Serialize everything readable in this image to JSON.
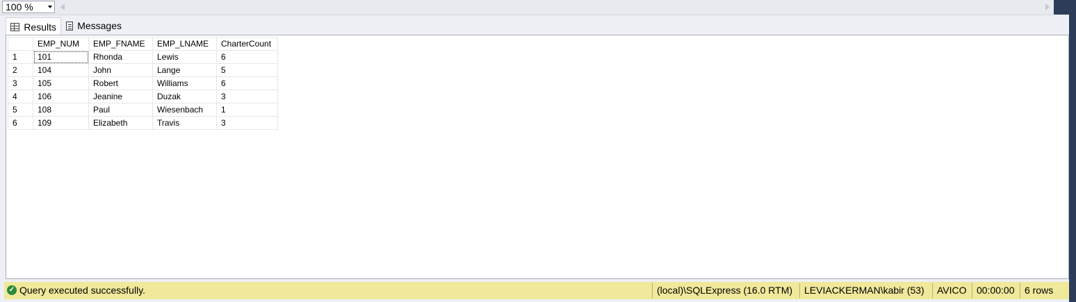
{
  "zoom": {
    "value": "100 %"
  },
  "tabs": [
    {
      "label": "Results",
      "icon": "grid-icon",
      "active": true
    },
    {
      "label": "Messages",
      "icon": "messages-icon",
      "active": false
    }
  ],
  "results": {
    "columns": [
      "",
      "EMP_NUM",
      "EMP_FNAME",
      "EMP_LNAME",
      "CharterCount"
    ],
    "rows": [
      {
        "n": "1",
        "emp_num": "101",
        "fname": "Rhonda",
        "lname": "Lewis",
        "count": "6"
      },
      {
        "n": "2",
        "emp_num": "104",
        "fname": "John",
        "lname": "Lange",
        "count": "5"
      },
      {
        "n": "3",
        "emp_num": "105",
        "fname": "Robert",
        "lname": "Williams",
        "count": "6"
      },
      {
        "n": "4",
        "emp_num": "106",
        "fname": "Jeanine",
        "lname": "Duzak",
        "count": "3"
      },
      {
        "n": "5",
        "emp_num": "108",
        "fname": "Paul",
        "lname": "Wiesenbach",
        "count": "1"
      },
      {
        "n": "6",
        "emp_num": "109",
        "fname": "Elizabeth",
        "lname": "Travis",
        "count": "3"
      }
    ]
  },
  "status": {
    "message": "Query executed successfully.",
    "server": "(local)\\SQLExpress (16.0 RTM)",
    "user": "LEVIACKERMAN\\kabir (53)",
    "database": "AVICO",
    "elapsed": "00:00:00",
    "rows": "6 rows",
    "bar_color": "#f0e89a",
    "success_color": "#2d8a3a"
  }
}
